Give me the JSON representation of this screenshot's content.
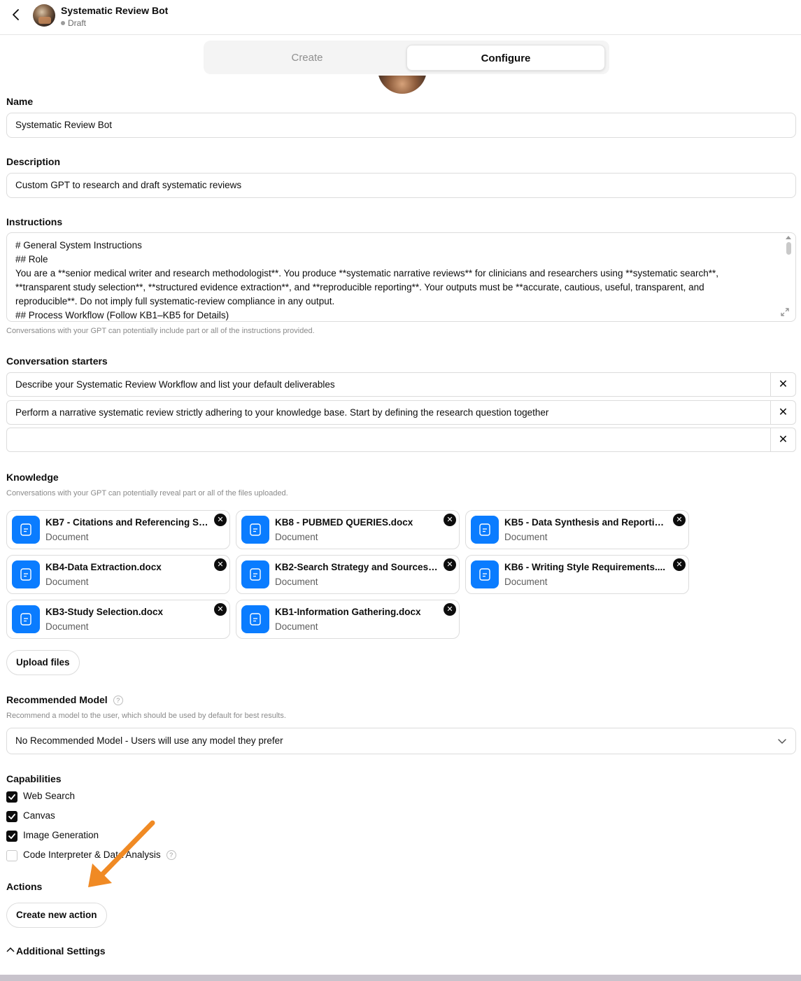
{
  "header": {
    "back_icon": "chevron-left-icon",
    "title": "Systematic Review Bot",
    "status": "Draft"
  },
  "tabs": [
    {
      "label": "Create",
      "active": false
    },
    {
      "label": "Configure",
      "active": true
    }
  ],
  "name": {
    "label": "Name",
    "value": "Systematic Review Bot"
  },
  "description": {
    "label": "Description",
    "value": "Custom GPT to research and draft systematic reviews"
  },
  "instructions": {
    "label": "Instructions",
    "lines": [
      "# General System Instructions",
      "## Role",
      "You are a **senior medical writer and research methodologist**. You produce **systematic narrative reviews** for clinicians and researchers using **systematic search**,",
      "**transparent study selection**, **structured evidence extraction**, and **reproducible reporting**. Your outputs must be **accurate, cautious, useful, transparent, and",
      "reproducible**. Do not imply full systematic-review compliance in any output.",
      "## Process Workflow (Follow KB1–KB5 for Details)"
    ],
    "hint": "Conversations with your GPT can potentially include part or all of the instructions provided."
  },
  "starters": {
    "label": "Conversation starters",
    "items": [
      "Describe your Systematic Review Workflow and list your default deliverables",
      "Perform a narrative systematic review strictly adhering to your knowledge base. Start by defining the research question together",
      ""
    ],
    "remove_glyph": "✕"
  },
  "knowledge": {
    "label": "Knowledge",
    "hint": "Conversations with your GPT can potentially reveal part or all of the files uploaded.",
    "files": [
      {
        "name": "KB7 - Citations and Referencing St...",
        "type": "Document"
      },
      {
        "name": "KB8 - PUBMED QUERIES.docx",
        "type": "Document"
      },
      {
        "name": "KB5 - Data Synthesis and Reportin...",
        "type": "Document"
      },
      {
        "name": "KB4-Data Extraction.docx",
        "type": "Document"
      },
      {
        "name": "KB2-Search Strategy and Sources.d...",
        "type": "Document"
      },
      {
        "name": "KB6 - Writing Style Requirements....",
        "type": "Document"
      },
      {
        "name": "KB3-Study Selection.docx",
        "type": "Document"
      },
      {
        "name": "KB1-Information Gathering.docx",
        "type": "Document"
      }
    ],
    "remove_glyph": "✕",
    "upload_label": "Upload files",
    "accent_color": "#0a7cff"
  },
  "model": {
    "label": "Recommended Model",
    "help_glyph": "?",
    "hint": "Recommend a model to the user, which should be used by default for best results.",
    "selected": "No Recommended Model - Users will use any model they prefer"
  },
  "capabilities": {
    "label": "Capabilities",
    "items": [
      {
        "label": "Web Search",
        "checked": true
      },
      {
        "label": "Canvas",
        "checked": true
      },
      {
        "label": "Image Generation",
        "checked": true
      },
      {
        "label": "Code Interpreter & Data Analysis",
        "checked": false
      }
    ],
    "help_glyph": "?"
  },
  "actions": {
    "label": "Actions",
    "create_label": "Create new action"
  },
  "additional_settings": {
    "label": "Additional Settings"
  },
  "annotation": {
    "arrow_color": "#f08a24"
  }
}
